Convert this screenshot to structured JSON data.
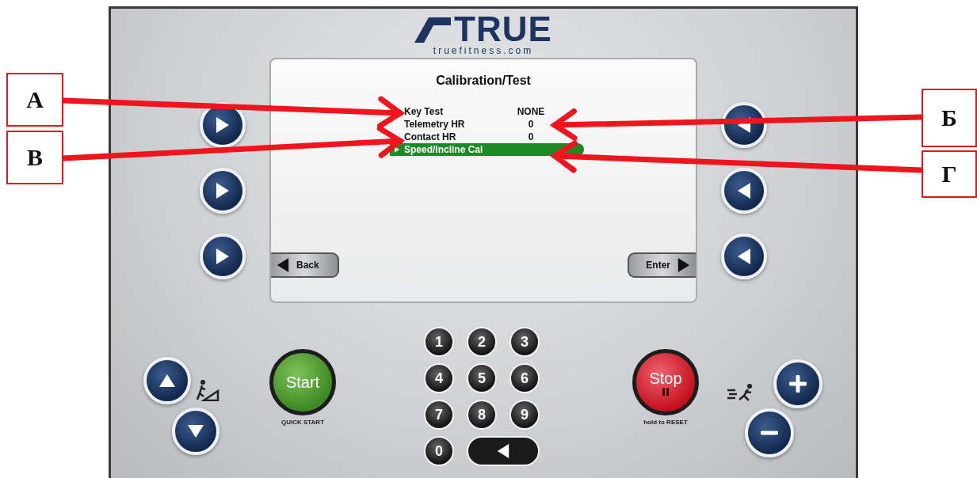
{
  "logo": {
    "brand": "TRUE",
    "site": "truefitness.com"
  },
  "screen": {
    "title": "Calibration/Test",
    "items": [
      {
        "label": "Key Test",
        "value": "NONE",
        "selected": false
      },
      {
        "label": "Telemetry HR",
        "value": "0",
        "selected": false
      },
      {
        "label": "Contact HR",
        "value": "0",
        "selected": false
      },
      {
        "label": "Speed/Incline Cal",
        "selected": true
      }
    ],
    "soft_keys": [
      {
        "label": "Back",
        "kind": "back"
      },
      {
        "label": "Enter",
        "kind": "enter"
      }
    ]
  },
  "start": {
    "label": "Start",
    "caption": "QUICK START"
  },
  "stop": {
    "label": "Stop",
    "caption": "hold to RESET"
  },
  "keypad": [
    "1",
    "2",
    "3",
    "4",
    "5",
    "6",
    "7",
    "8",
    "9",
    "0"
  ],
  "callouts": [
    {
      "label": "А"
    },
    {
      "label": "Б"
    },
    {
      "label": "В"
    },
    {
      "label": "Г"
    }
  ]
}
